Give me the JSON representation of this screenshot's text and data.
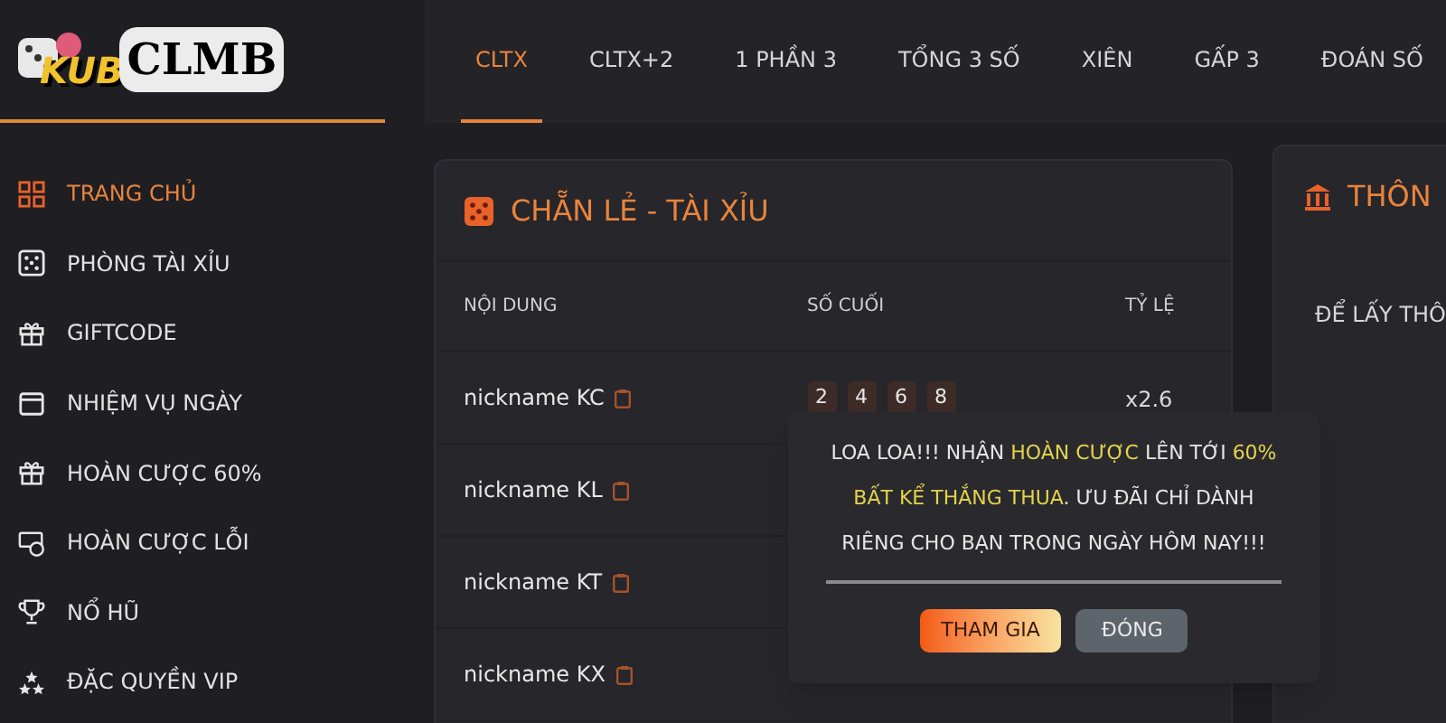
{
  "logo": {
    "part_1": "KUB",
    "part_2": "CLMB"
  },
  "tabs": [
    {
      "label": "CLTX",
      "selected": true
    },
    {
      "label": "CLTX+2",
      "selected": false
    },
    {
      "label": "1 PHẦN 3",
      "selected": false
    },
    {
      "label": "TỔNG 3 SỐ",
      "selected": false
    },
    {
      "label": "XIÊN",
      "selected": false
    },
    {
      "label": "GẤP 3",
      "selected": false
    },
    {
      "label": "ĐOÁN SỐ",
      "selected": false
    }
  ],
  "sidebar": {
    "items": [
      {
        "label": "TRANG CHỦ",
        "selected": true
      },
      {
        "label": "PHÒNG TÀI XỈU",
        "selected": false
      },
      {
        "label": "GIFTCODE",
        "selected": false
      },
      {
        "label": "NHIỆM VỤ NGÀY",
        "selected": false
      },
      {
        "label": "HOÀN CƯỢC 60%",
        "selected": false
      },
      {
        "label": "HOÀN CƯỢC LỖI",
        "selected": false
      },
      {
        "label": "NỔ HŨ",
        "selected": false
      },
      {
        "label": "ĐẶC QUYỀN VIP",
        "selected": false
      }
    ]
  },
  "main_card": {
    "title": "CHẴN LẺ - TÀI XỈU",
    "table": {
      "columns": [
        "NỘI DUNG",
        "SỐ CUỐI",
        "TỶ LỆ"
      ],
      "rows": [
        {
          "name": "nickname KC",
          "digits": [
            "2",
            "4",
            "6",
            "8"
          ],
          "rate": "x2.6"
        },
        {
          "name": "nickname KL"
        },
        {
          "name": "nickname KT"
        },
        {
          "name": "nickname KX"
        }
      ]
    }
  },
  "side_card": {
    "title": "THÔN",
    "text": "ĐỂ LẤY THÔ"
  },
  "popup": {
    "message": [
      {
        "text": "LOA LOA!!! NHẬN ",
        "highlight": false
      },
      {
        "text": "HOÀN CƯỢC",
        "highlight": true
      },
      {
        "text": " LÊN TỚI ",
        "highlight": false
      },
      {
        "text": "60% BẤT KỂ THẮNG THUA",
        "highlight": true
      },
      {
        "text": ". ƯU ĐÃI CHỈ DÀNH RIÊNG CHO BẠN TRONG NGÀY HÔM NAY!!!",
        "highlight": false
      }
    ],
    "buttons": [
      {
        "label": "THAM GIA",
        "kind": "primary"
      },
      {
        "label": "ĐÓNG",
        "kind": "secondary"
      }
    ]
  }
}
